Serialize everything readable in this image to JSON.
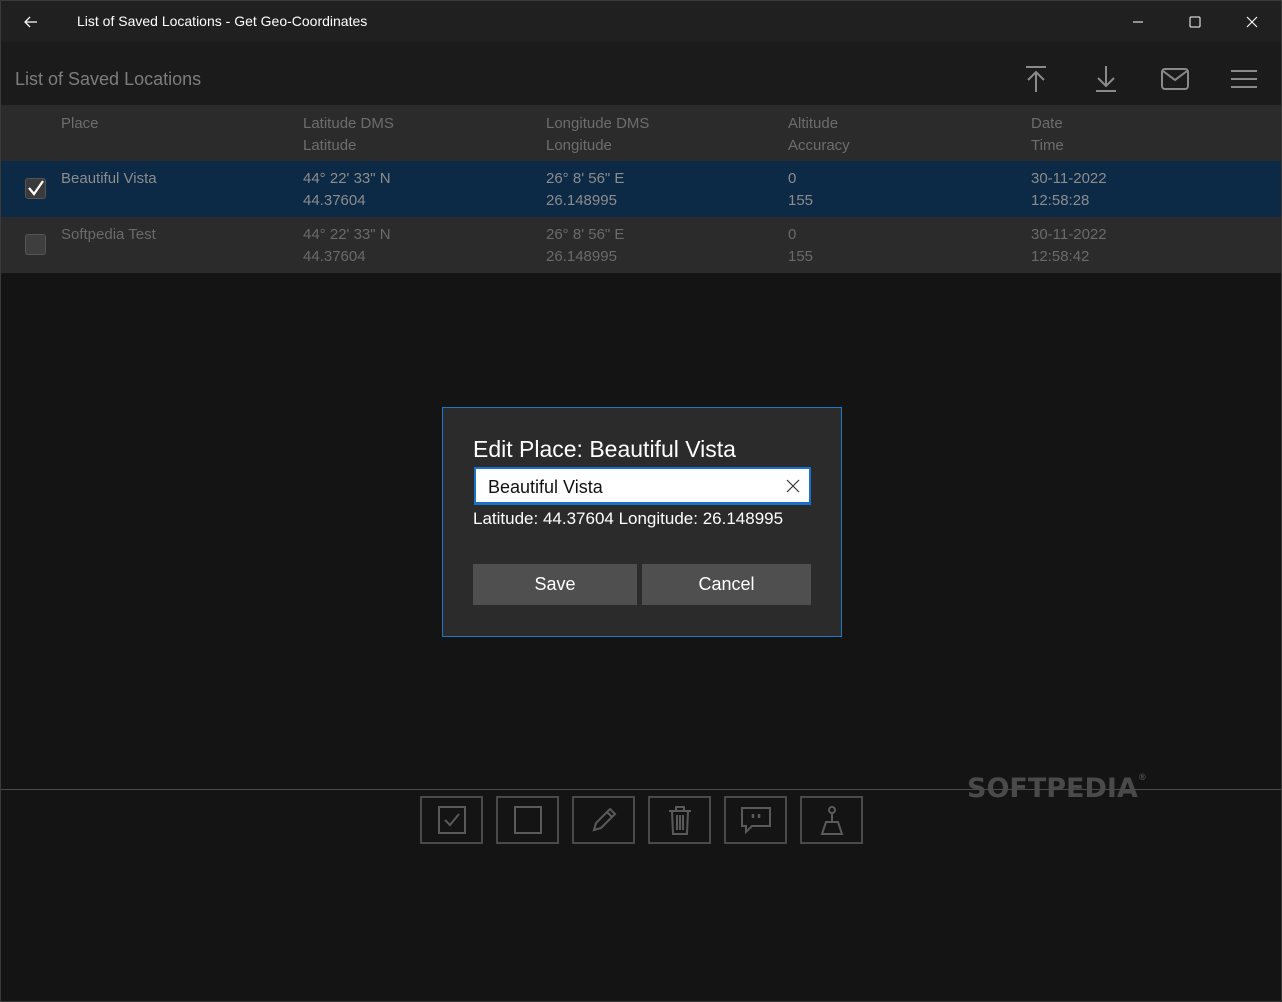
{
  "window": {
    "title": "List of Saved Locations - Get Geo-Coordinates"
  },
  "header": {
    "page_title": "List of Saved Locations",
    "icons": [
      "upload-icon",
      "download-icon",
      "mail-icon",
      "menu-icon"
    ]
  },
  "table": {
    "columns": [
      {
        "line1": "Place",
        "line2": ""
      },
      {
        "line1": "Latitude DMS",
        "line2": "Latitude"
      },
      {
        "line1": "Longitude DMS",
        "line2": "Longitude"
      },
      {
        "line1": "Altitude",
        "line2": "Accuracy"
      },
      {
        "line1": "Date",
        "line2": "Time"
      }
    ],
    "rows": [
      {
        "checked": true,
        "place": "Beautiful Vista",
        "lat_dms": "44° 22' 33\" N",
        "lat": "44.37604",
        "lon_dms": "26° 8' 56\" E",
        "lon": "26.148995",
        "altitude": "0",
        "accuracy": "155",
        "date": "30-11-2022",
        "time": "12:58:28"
      },
      {
        "checked": false,
        "place": "Softpedia Test",
        "lat_dms": "44° 22' 33\" N",
        "lat": "44.37604",
        "lon_dms": "26° 8' 56\" E",
        "lon": "26.148995",
        "altitude": "0",
        "accuracy": "155",
        "date": "30-11-2022",
        "time": "12:58:42"
      }
    ]
  },
  "dialog": {
    "title": "Edit Place: Beautiful Vista",
    "input_value": "Beautiful Vista",
    "coords_text": "Latitude: 44.37604 Longitude: 26.148995",
    "save_label": "Save",
    "cancel_label": "Cancel"
  },
  "toolbar": {
    "icons": [
      "select-all-icon",
      "deselect-icon",
      "edit-icon",
      "delete-icon",
      "comment-icon",
      "map-pin-icon"
    ]
  },
  "watermark": "SOFTPEDIA",
  "colors": {
    "selected_row": "#0c2a45",
    "accent": "#1e78c8"
  }
}
